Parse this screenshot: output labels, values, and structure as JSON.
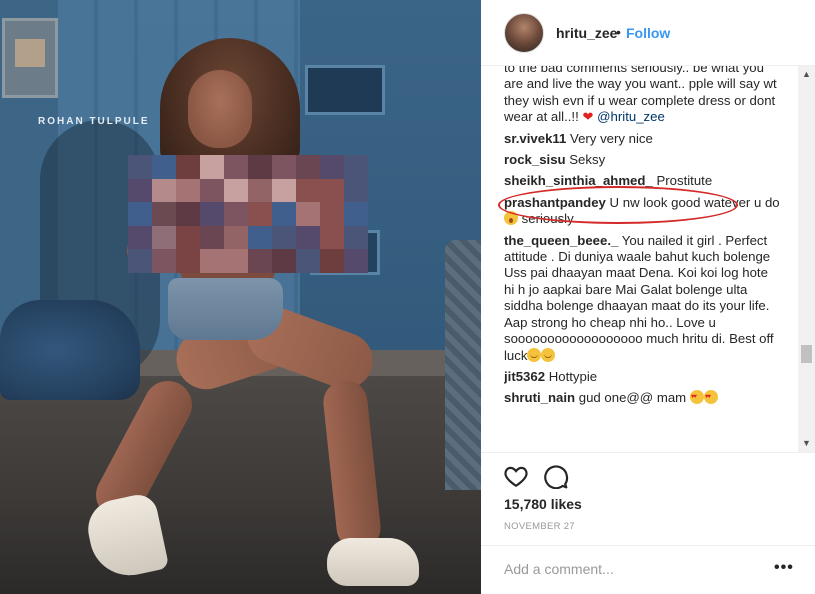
{
  "post": {
    "username": "hritu_zee",
    "separator": "•",
    "follow_label": "Follow",
    "photo_credit": "ROHAN TULPULE"
  },
  "comments": [
    {
      "user": "",
      "text": "to the bad comments seriously.. be what you are and live the way you want.. pple will say wt they wish evn if u wear complete dress or dont wear at all..!! ",
      "mention": "@hritu_zee",
      "emoji": "heart"
    },
    {
      "user": "sr.vivek11",
      "text": "Very very nice"
    },
    {
      "user": "rock_sisu",
      "text": "Seksy"
    },
    {
      "user": "sheikh_sinthia_ahmed_",
      "text": "Prostitute",
      "highlighted": true
    },
    {
      "user": "prashantpandey",
      "text": "U nw look good watever u do ",
      "emoji_after": "seriously"
    },
    {
      "user": "the_queen_beee._",
      "text": "You nailed it girl . Perfect attitude . Di duniya waale bahut kuch bolenge Uss pai dhaayan maat Dena. Koi koi log hote hi h jo aapkai bare Mai Galat bolenge ulta siddha bolenge dhaayan maat do its your life. Aap strong ho cheap nhi ho.. Love u soooooooooooooooooo much hritu di. Best off luck"
    },
    {
      "user": "jit5362",
      "text": "Hottypie"
    },
    {
      "user": "shruti_nain",
      "text": "gud one@@ mam"
    }
  ],
  "actions": {
    "likes": "15,780 likes",
    "date": "NOVEMBER 27",
    "add_comment_placeholder": "Add a comment...",
    "more": "•••"
  },
  "icons": [
    "heart-icon",
    "comment-icon",
    "more-options-icon"
  ],
  "colors": {
    "link": "#3897f0",
    "highlight_circle": "#d42a2a",
    "text": "#262626",
    "muted": "#999999"
  }
}
